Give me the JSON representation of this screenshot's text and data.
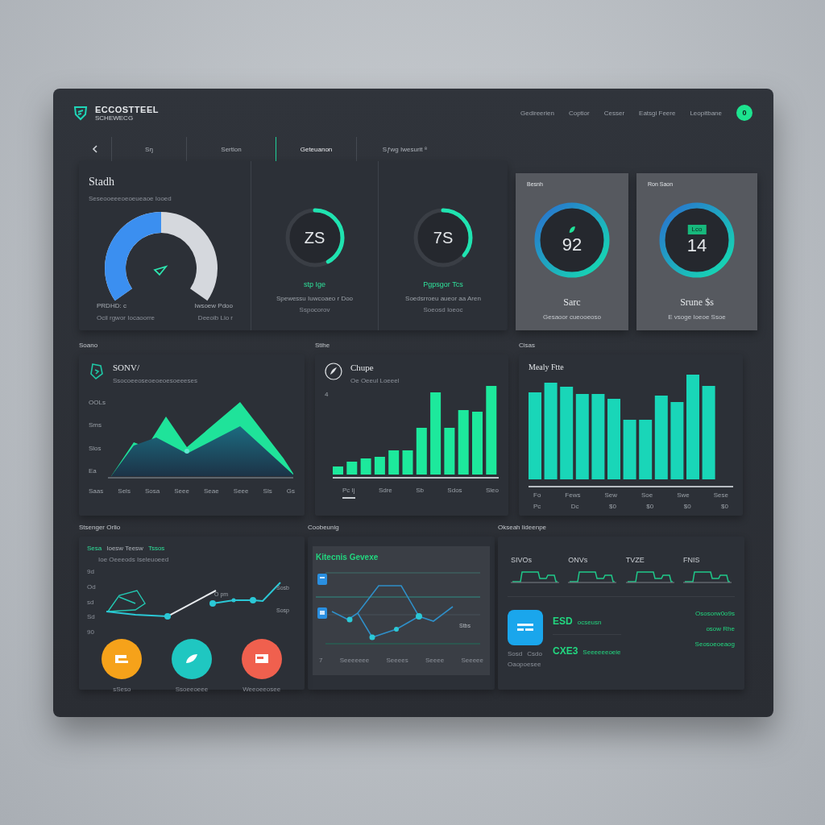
{
  "header": {
    "brand": "ECCOSTTEEL",
    "brand_sub": "SCHEWECG",
    "nav": [
      "Gedireerien",
      "Coptior",
      "Cesser",
      "Eatsgi Feere",
      "Leopitbane"
    ],
    "avatar": "0"
  },
  "tabs": [
    {
      "label": "Sŋ",
      "selected": false
    },
    {
      "label": "Sertion",
      "selected": false
    },
    {
      "label": "Geteuanon",
      "selected": true
    },
    {
      "label": "Sƒwg Iwesurit ⁸",
      "selected": false
    }
  ],
  "overview": {
    "title": "Stadh",
    "subtitle": "Seseooeeeoeoeueaoe Iooed",
    "gauge": {
      "left_label": "PRDHD: c",
      "left_note": "Ocil rgwor Iocaoorre",
      "right_label": "Iwsoew Pdoo",
      "right_note": "Deeoib Lio r"
    },
    "rings": [
      {
        "value": "ZS",
        "caption": "stp Ige",
        "detail": "Spewessu Iuwcoaeo r Doo",
        "note": "Sspocorov"
      },
      {
        "value": "7S",
        "caption": "Pgpsgor Tcs",
        "detail": "Soedsrroeu aueor aa Aren",
        "note": "Soeosd Ioeoc"
      }
    ]
  },
  "kpis": [
    {
      "label": "Besnh",
      "value": "92",
      "caption": "Sarc",
      "detail": "Gesaoor cueooeoso"
    },
    {
      "label": "Ron Saon",
      "value": "14",
      "badge": "Lco",
      "caption": "Srune $s",
      "detail": "E vsoge Ioeoe Ssoe"
    }
  ],
  "charts": [
    {
      "kind": "area",
      "heading": "Soano",
      "title": "SONV/",
      "subtitle": "Ssocoeeoseoeoeoesoeeeses",
      "y_labels": [
        "OOLs",
        "Sms",
        "Slos",
        "Ea"
      ],
      "x_labels": [
        "Saas",
        "Sels",
        "Sosa",
        "Seee",
        "Seae",
        "Seee",
        "Sls",
        "Gs"
      ]
    },
    {
      "kind": "bars",
      "heading": "Stihe",
      "title": "Chupe",
      "subtitle": "Oe Oeeul Loeeel",
      "y_labels": [
        "4"
      ],
      "x_labels": [
        "Pc Ij",
        "Sdre",
        "Sb",
        "Sdos",
        "Sleo"
      ]
    },
    {
      "kind": "columns",
      "heading": "Cisas",
      "title": "Mealy Ftte",
      "x_labels": [
        "Fo",
        "Fews",
        "Sew",
        "Soe",
        "Swe",
        "Sese"
      ],
      "x_labels_2": [
        "Pc",
        "Dc",
        "$0",
        "$0",
        "$0",
        "$0"
      ]
    }
  ],
  "trend": {
    "heading": "Stsenger Orlio",
    "legend_tag": "Sesa",
    "legend_text": "Ioesw Teesw",
    "legend_value": "Tssos",
    "legend_sub": "Ioe Oeeeods Iseleuoeed",
    "y_labels": [
      "9d",
      "Od",
      "sd",
      "Sd",
      "90"
    ],
    "annotations": [
      "O pm",
      "Sosb",
      "Sosp"
    ],
    "categories": [
      {
        "label": "sSeso",
        "color": "#f6a21a"
      },
      {
        "label": "Ssoeeoeee",
        "color": "#1fc7c1"
      },
      {
        "label": "Weeoeeosee",
        "color": "#f0604e"
      }
    ]
  },
  "monitor": {
    "heading": "Coobeunig",
    "title": "Kitecnis Gevexe",
    "annotation": "Stbs",
    "x_labels": [
      "7",
      "Seeeeeee",
      "Seeees",
      "Seeee",
      "Seeeee"
    ]
  },
  "summary": {
    "heading": "Okseah lideenpe",
    "metrics": [
      "SIVOs",
      "ONVs",
      "TVZE",
      "FNIS"
    ],
    "rows": [
      {
        "code": "ESD",
        "text": "ocseusn"
      },
      {
        "code": "CXE3",
        "text": "Seeeeeeoeie"
      }
    ],
    "values": [
      "Ososorw0o9s",
      "osow Rhe",
      "Seosoeoeaog"
    ],
    "app_notes": [
      "Sosd",
      "Csdo",
      "Oaopoesee"
    ]
  }
}
